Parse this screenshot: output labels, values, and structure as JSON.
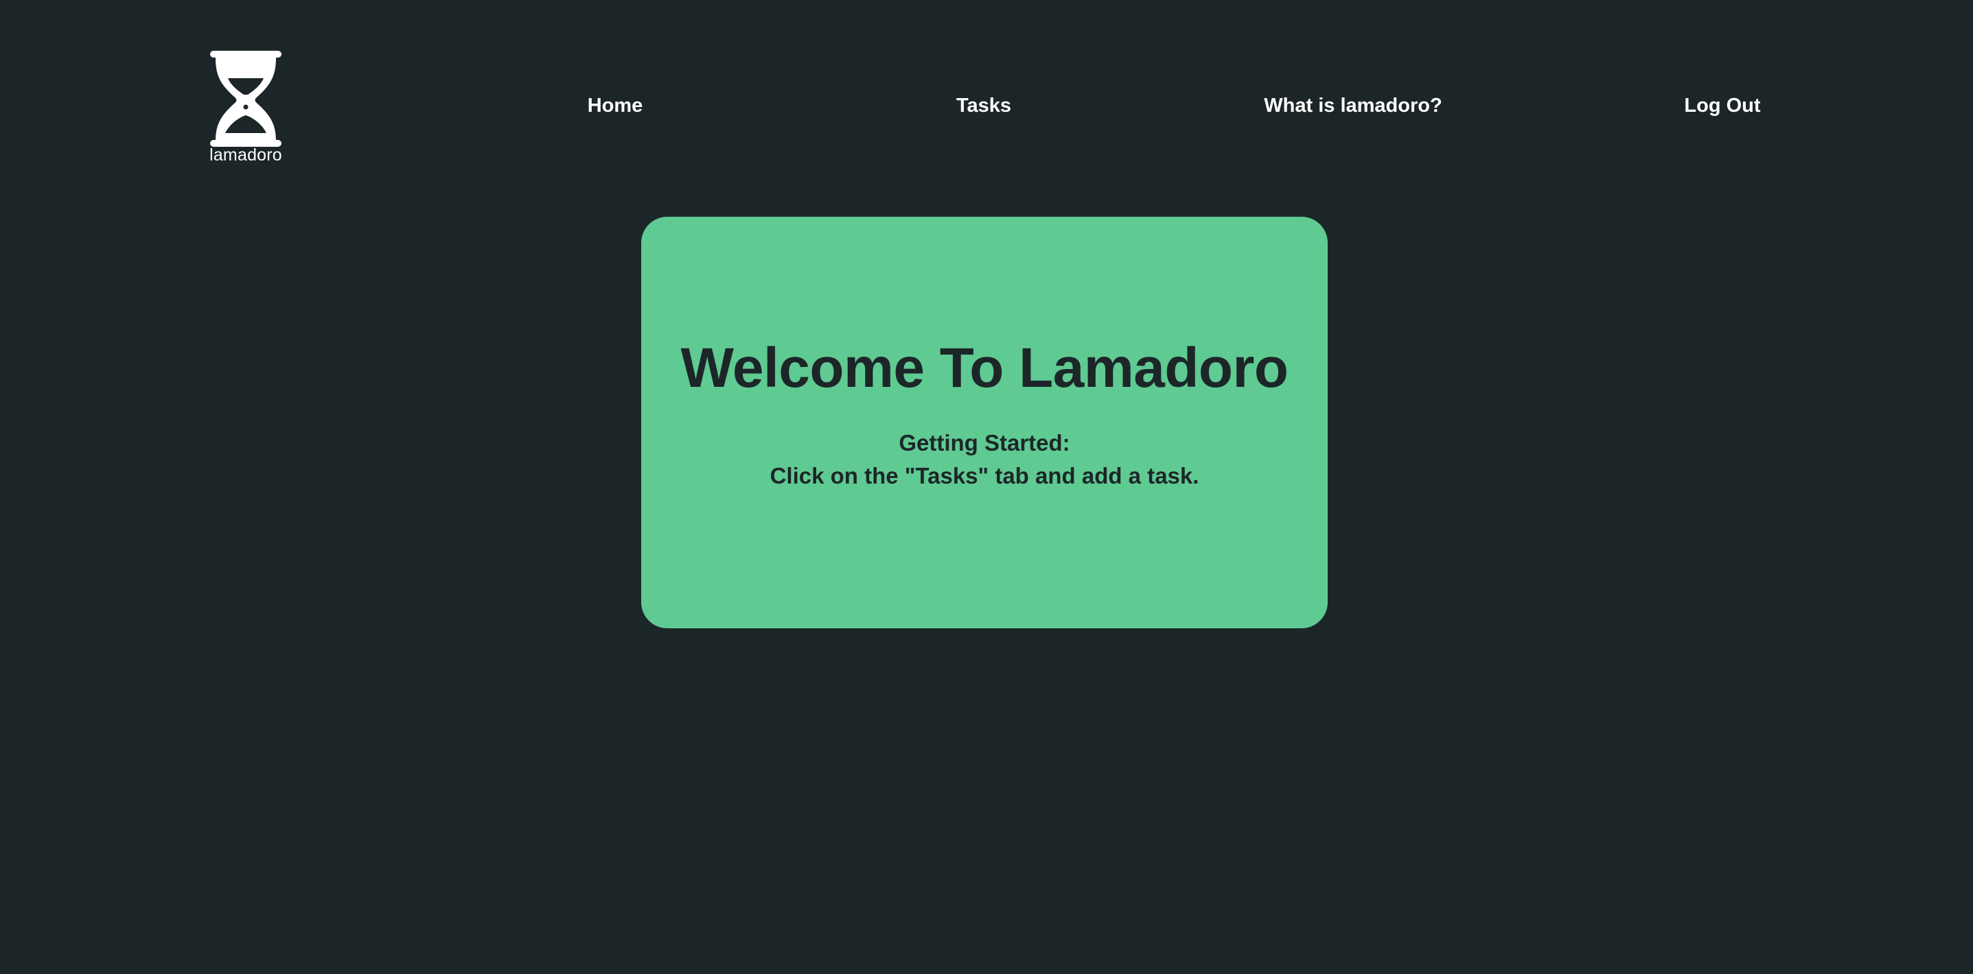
{
  "logo": {
    "icon": "hourglass-icon",
    "text": "lamadoro"
  },
  "nav": {
    "home": "Home",
    "tasks": "Tasks",
    "what": "What is lamadoro?",
    "logout": "Log Out"
  },
  "welcome": {
    "title": "Welcome To Lamadoro",
    "getting_started": "Getting Started:",
    "instruction": "Click on the \"Tasks\" tab and add a task."
  },
  "colors": {
    "background": "#1c2628",
    "card": "#5fca92",
    "text_light": "#ffffff",
    "text_dark": "#1c2628"
  }
}
